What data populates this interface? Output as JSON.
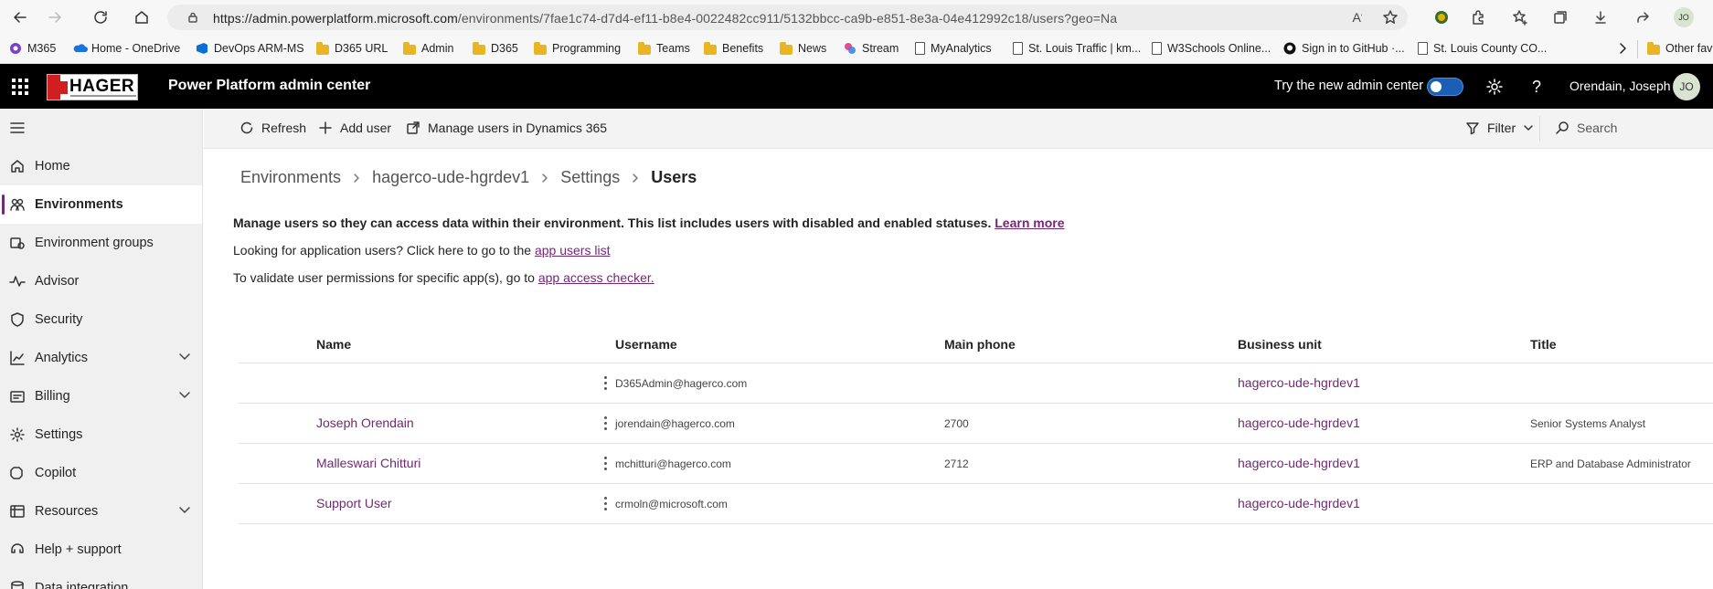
{
  "browser": {
    "url_host": "https://admin.powerplatform.microsoft.com",
    "url_path": "/environments/7fae1c74-d7d4-ef11-b8e4-0022482cc911/5132bbcc-ca9b-e851-8e3a-04e412992c18/users?geo=Na",
    "profile_initials": "JO"
  },
  "favorites": [
    {
      "label": "M365",
      "icon": "m365-icon"
    },
    {
      "label": "Home - OneDrive",
      "icon": "onedrive-icon"
    },
    {
      "label": "DevOps ARM-MS",
      "icon": "devops-icon"
    },
    {
      "label": "D365 URL",
      "icon": "folder-icon"
    },
    {
      "label": "Admin",
      "icon": "folder-icon"
    },
    {
      "label": "D365",
      "icon": "folder-icon"
    },
    {
      "label": "Programming",
      "icon": "folder-icon"
    },
    {
      "label": "Teams",
      "icon": "folder-icon"
    },
    {
      "label": "Benefits",
      "icon": "folder-icon"
    },
    {
      "label": "News",
      "icon": "folder-icon"
    },
    {
      "label": "Stream",
      "icon": "stream-icon"
    },
    {
      "label": "MyAnalytics",
      "icon": "page-icon"
    },
    {
      "label": "St. Louis Traffic | km...",
      "icon": "page-icon"
    },
    {
      "label": "W3Schools Online...",
      "icon": "page-icon"
    },
    {
      "label": "Sign in to GitHub ·...",
      "icon": "github-icon"
    },
    {
      "label": "St. Louis County CO...",
      "icon": "page-icon"
    },
    {
      "label": "Other fav",
      "icon": "folder-icon"
    }
  ],
  "header": {
    "logo_text": "HAGER",
    "title": "Power Platform admin center",
    "try_new_label": "Try the new admin center",
    "toggle_on": true,
    "user_name": "Orendain, Joseph",
    "user_initials": "JO"
  },
  "sidebar": {
    "items": [
      {
        "label": "Home",
        "icon": "home-icon",
        "expandable": false
      },
      {
        "label": "Environments",
        "icon": "environments-icon",
        "expandable": false,
        "active": true
      },
      {
        "label": "Environment groups",
        "icon": "environment-groups-icon",
        "expandable": false
      },
      {
        "label": "Advisor",
        "icon": "advisor-icon",
        "expandable": false
      },
      {
        "label": "Security",
        "icon": "shield-icon",
        "expandable": false
      },
      {
        "label": "Analytics",
        "icon": "analytics-icon",
        "expandable": true
      },
      {
        "label": "Billing",
        "icon": "billing-icon",
        "expandable": true
      },
      {
        "label": "Settings",
        "icon": "gear-icon",
        "expandable": false
      },
      {
        "label": "Copilot",
        "icon": "copilot-icon",
        "expandable": false
      },
      {
        "label": "Resources",
        "icon": "resources-icon",
        "expandable": true
      },
      {
        "label": "Help + support",
        "icon": "help-support-icon",
        "expandable": false
      },
      {
        "label": "Data integration",
        "icon": "data-integration-icon",
        "expandable": false
      }
    ]
  },
  "commandbar": {
    "refresh": "Refresh",
    "add_user": "Add user",
    "manage_users": "Manage users in Dynamics 365",
    "filter": "Filter",
    "search": "Search"
  },
  "breadcrumb": [
    "Environments",
    "hagerco-ude-hgrdev1",
    "Settings",
    "Users"
  ],
  "info": {
    "line1": "Manage users so they can access data within their environment. This list includes users with disabled and enabled statuses.",
    "line1_link": "Learn more",
    "line2": "Looking for application users? Click here to go to the",
    "line2_link": "app users list",
    "line3": "To validate user permissions for specific app(s), go to",
    "line3_link": "app access checker."
  },
  "table": {
    "columns": [
      "Name",
      "Username",
      "Main phone",
      "Business unit",
      "Title"
    ],
    "rows": [
      {
        "name": "",
        "username": "D365Admin@hagerco.com",
        "phone": "",
        "business_unit": "hagerco-ude-hgrdev1",
        "title": ""
      },
      {
        "name": "Joseph Orendain",
        "username": "jorendain@hagerco.com",
        "phone": "2700",
        "business_unit": "hagerco-ude-hgrdev1",
        "title": "Senior Systems Analyst"
      },
      {
        "name": "Malleswari Chitturi",
        "username": "mchitturi@hagerco.com",
        "phone": "2712",
        "business_unit": "hagerco-ude-hgrdev1",
        "title": "ERP and Database Administrator"
      },
      {
        "name": "Support User",
        "username": "crmoln@microsoft.com",
        "phone": "",
        "business_unit": "hagerco-ude-hgrdev1",
        "title": ""
      }
    ]
  }
}
